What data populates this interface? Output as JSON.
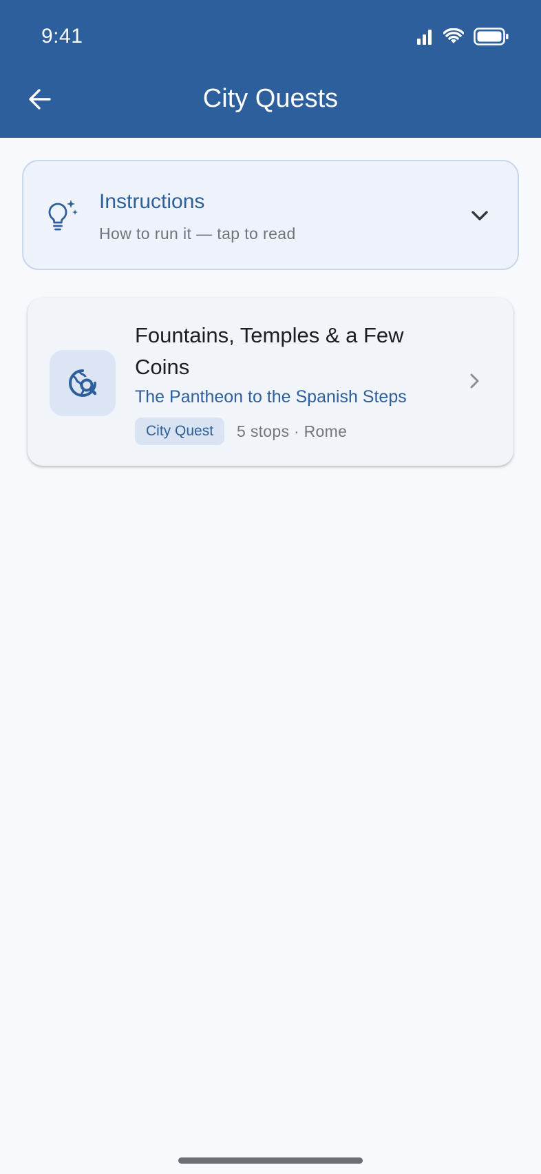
{
  "status_bar": {
    "time": "9:41",
    "icons": [
      "signal-icon",
      "wifi-icon",
      "battery-icon"
    ]
  },
  "app_bar": {
    "title": "City Quests",
    "back_icon": "arrow-left-icon"
  },
  "instructions": {
    "icon": "lightbulb-sparkle-icon",
    "title": "Instructions",
    "subtitle": "How to run it — tap to read",
    "expand_icon": "chevron-down-icon"
  },
  "quests": [
    {
      "icon": "travel-explore-icon",
      "title": "Fountains, Temples & a Few Coins",
      "subtitle": "The Pantheon to the Spanish Steps",
      "badge": "City Quest",
      "stats": "5 stops · Rome",
      "chevron_icon": "chevron-right-icon"
    }
  ],
  "colors": {
    "primary": "#2c5f9b",
    "background": "#f7f9fd",
    "card": "#f1f4f9",
    "instructions_bg": "#eef2fa",
    "badge_bg": "#d9e3f1"
  }
}
